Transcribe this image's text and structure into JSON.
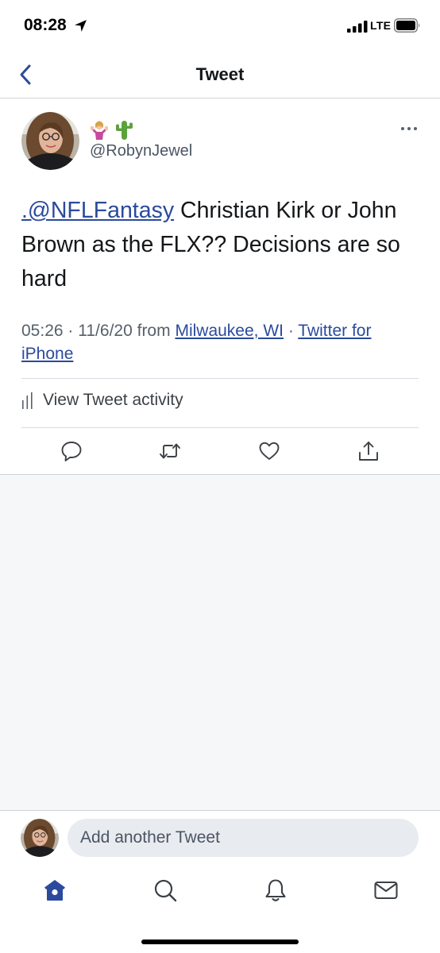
{
  "status_bar": {
    "time": "08:28",
    "network": "LTE"
  },
  "header": {
    "title": "Tweet"
  },
  "tweet": {
    "display_name_emojis": [
      "person-shrugging-emoji",
      "cactus-emoji"
    ],
    "handle": "@RobynJewel",
    "text_mention": ".@NFLFantasy",
    "text_body": " Christian Kirk or John Brown as the FLX?? Decisions are so hard",
    "meta": {
      "time": "05:26",
      "date": "11/6/20",
      "from_label": "from",
      "location": "Milwaukee, WI",
      "source": "Twitter for iPhone",
      "separator": "·"
    },
    "activity_label": "View Tweet activity",
    "actions": [
      "reply-icon",
      "retweet-icon",
      "like-icon",
      "share-icon"
    ]
  },
  "compose": {
    "placeholder": "Add another Tweet"
  },
  "tab_bar": {
    "tabs": [
      "home-icon",
      "search-icon",
      "notifications-icon",
      "messages-icon"
    ],
    "active": "home-icon"
  },
  "colors": {
    "link": "#2b4a9d",
    "accent": "#2b4a9d",
    "text": "#14171a",
    "secondary_text": "#57606a",
    "background_grey": "#f5f7f9",
    "input_bg": "#e8ebef"
  }
}
